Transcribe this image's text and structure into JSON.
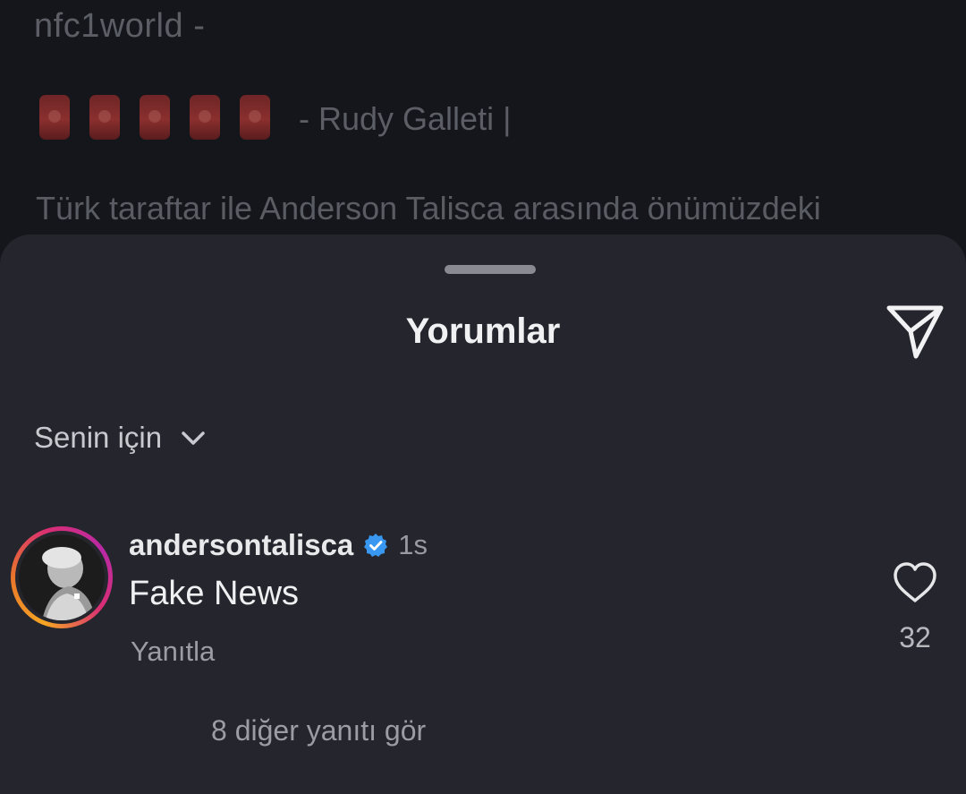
{
  "post": {
    "author": "nfc1world -",
    "flag_icons": [
      "turkey-flag-icon",
      "turkey-flag-icon",
      "turkey-flag-icon",
      "turkey-flag-icon",
      "turkey-flag-icon"
    ],
    "byline": "- Rudy Galleti |",
    "text": "Türk taraftar ile Anderson Talisca arasında önümüzdeki"
  },
  "comments_sheet": {
    "title": "Yorumlar",
    "share_icon": "send-icon",
    "filter_label": "Senin için",
    "filter_icon": "chevron-down-icon"
  },
  "comment": {
    "username": "andersontalisca",
    "verified_icon": "verified-badge-icon",
    "time": "1s",
    "text": "Fake News",
    "reply_label": "Yanıtla",
    "like_icon": "heart-icon",
    "like_count": "32",
    "more_replies": "8 diğer yanıtı gör"
  },
  "colors": {
    "sheet_bg": "#25262d",
    "verified_blue": "#3897f0",
    "story_ring_start": "#f5a623",
    "story_ring_end": "#d92e74"
  }
}
